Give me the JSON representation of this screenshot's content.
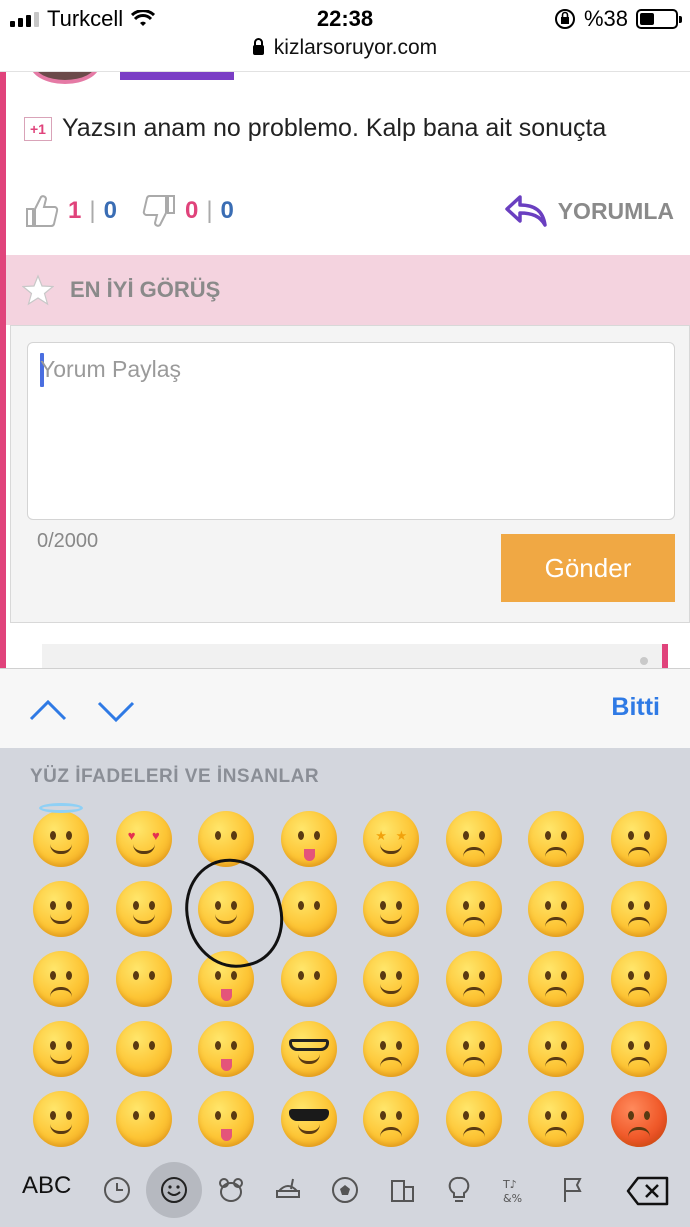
{
  "status_bar": {
    "carrier": "Turkcell",
    "time": "22:38",
    "battery": "%38"
  },
  "browser": {
    "url": "kizlarsoruyor.com"
  },
  "comment": {
    "badge": "+1",
    "text": "Yazsın anam no problemo. Kalp bana ait sonuçta"
  },
  "reactions": {
    "like_pink": "1",
    "like_blue": "0",
    "dislike_pink": "0",
    "dislike_blue": "0",
    "separator": "|",
    "reply_label": "YORUMLA"
  },
  "best": {
    "label": "EN İYİ GÖRÜŞ"
  },
  "form": {
    "placeholder": "Yorum Paylaş",
    "counter": "0/2000",
    "submit_label": "Gönder"
  },
  "keyboard_toolbar": {
    "done_label": "Bitti"
  },
  "emoji_keyboard": {
    "section_title": "YÜZ İFADELERİ VE İNSANLAR",
    "abc_label": "ABC",
    "categories": [
      "recent-icon",
      "smiley-icon",
      "animal-icon",
      "food-icon",
      "ball-icon",
      "building-icon",
      "bulb-icon",
      "symbols-icon",
      "flag-icon"
    ],
    "rows": [
      [
        "innocent-face",
        "heart-eyes-face",
        "kissing-closed-eyes-face",
        "zany-face",
        "star-struck-face",
        "pensive-face",
        "confounded-face",
        "crying-face"
      ],
      [
        "slightly-smiling-face",
        "smiling-hearts-face",
        "yum-face",
        "raised-eyebrow-face",
        "partying-face",
        "worried-face",
        "persevering-face",
        "loudly-crying-face"
      ],
      [
        "upside-down-face",
        "kissing-heart-face",
        "tongue-out-face",
        "monocle-face",
        "smirk-face",
        "confused-face",
        "tired-face",
        "steam-nose-face"
      ],
      [
        "winking-face",
        "kissing-face",
        "squinting-tongue-face",
        "nerd-face",
        "unamused-face",
        "slightly-frowning-face",
        "weary-face",
        "angry-face"
      ],
      [
        "relieved-face",
        "kissing-smiling-eyes-face",
        "winking-tongue-face",
        "sunglasses-face",
        "disappointed-face",
        "frowning-face",
        "pleading-face",
        "pouting-face"
      ]
    ]
  },
  "colors": {
    "accent_pink": "#e0437b",
    "accent_blue": "#3a6db4",
    "submit_orange": "#f0a844",
    "ios_blue": "#2f7ae5"
  }
}
